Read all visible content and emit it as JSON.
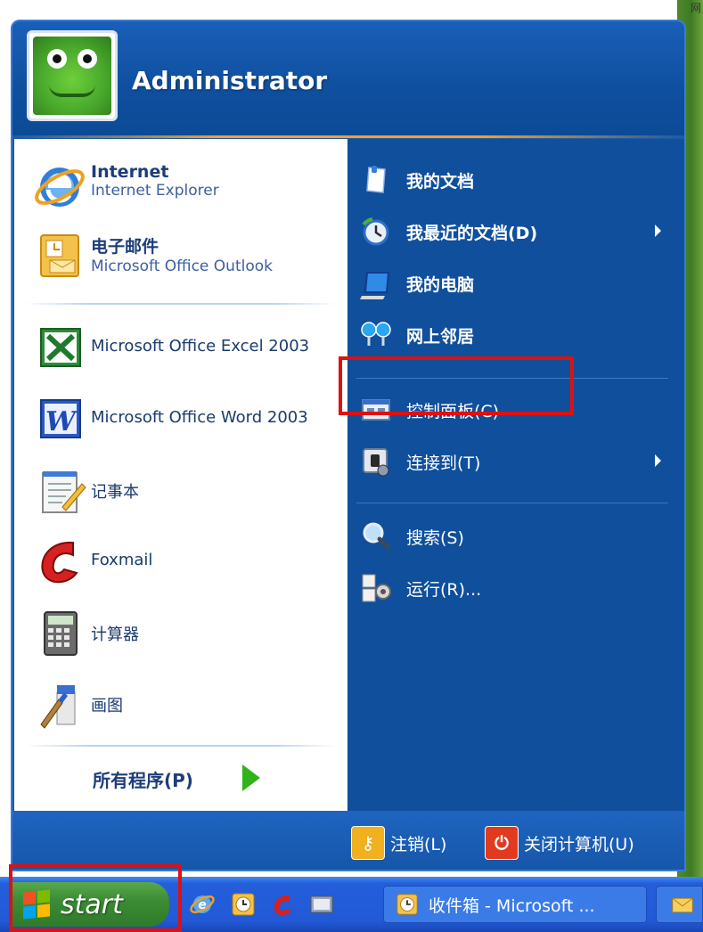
{
  "desktop": {
    "top_right_text": "网"
  },
  "start_menu": {
    "user_name": "Administrator",
    "pinned": [
      {
        "title": "Internet",
        "subtitle": "Internet Explorer",
        "icon": "internet-explorer-icon"
      },
      {
        "title": "电子邮件",
        "subtitle": "Microsoft Office Outlook",
        "icon": "outlook-icon"
      }
    ],
    "recent": [
      {
        "label": "Microsoft Office Excel 2003",
        "icon": "excel-icon"
      },
      {
        "label": "Microsoft Office Word 2003",
        "icon": "word-icon"
      },
      {
        "label": "记事本",
        "icon": "notepad-icon"
      },
      {
        "label": "Foxmail",
        "icon": "foxmail-icon"
      },
      {
        "label": "计算器",
        "icon": "calculator-icon"
      },
      {
        "label": "画图",
        "icon": "paint-icon"
      }
    ],
    "all_programs": "所有程序(P)",
    "right_items": [
      {
        "label": "我的文档",
        "icon": "my-documents-icon",
        "bold": true,
        "submenu": false
      },
      {
        "label": "我最近的文档(D)",
        "icon": "recent-documents-icon",
        "bold": true,
        "submenu": true
      },
      {
        "label": "我的电脑",
        "icon": "my-computer-icon",
        "bold": true,
        "submenu": false
      },
      {
        "label": "网上邻居",
        "icon": "network-places-icon",
        "bold": true,
        "submenu": false
      },
      {
        "label": "控制面板(C)",
        "icon": "control-panel-icon",
        "bold": false,
        "submenu": false
      },
      {
        "label": "连接到(T)",
        "icon": "connect-to-icon",
        "bold": false,
        "submenu": true
      },
      {
        "label": "搜索(S)",
        "icon": "search-icon",
        "bold": false,
        "submenu": false
      },
      {
        "label": "运行(R)...",
        "icon": "run-icon",
        "bold": false,
        "submenu": false
      }
    ],
    "logoff": "注销(L)",
    "shutdown": "关闭计算机(U)"
  },
  "taskbar": {
    "start_label": "start",
    "quick_launch": [
      "internet-explorer-icon",
      "clock-icon",
      "foxmail-icon",
      "desktop-icon"
    ],
    "task_buttons": [
      {
        "label": "收件箱 - Microsoft ...",
        "icon": "outlook-icon"
      },
      {
        "label": "",
        "icon": "mail-icon"
      }
    ]
  },
  "colors": {
    "menu_blue": "#1c5aa6",
    "highlight_red": "#e01010",
    "start_green": "#3c8d35",
    "taskbar_blue": "#245edb"
  }
}
